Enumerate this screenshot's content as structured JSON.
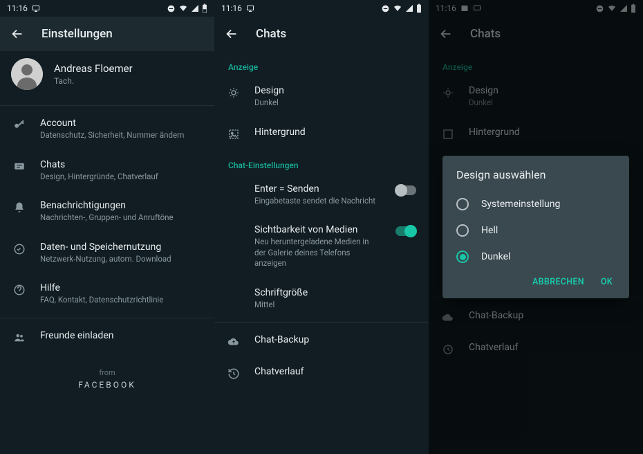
{
  "status": {
    "time": "11:16"
  },
  "pane1": {
    "title": "Einstellungen",
    "profile": {
      "name": "Andreas Floemer",
      "status": "Tach."
    },
    "items": [
      {
        "title": "Account",
        "sub": "Datenschutz, Sicherheit, Nummer ändern"
      },
      {
        "title": "Chats",
        "sub": "Design, Hintergründe, Chatverlauf"
      },
      {
        "title": "Benachrichtigungen",
        "sub": "Nachrichten-, Gruppen- und Anruftöne"
      },
      {
        "title": "Daten- und Speichernutzung",
        "sub": "Netzwerk-Nutzung, autom. Download"
      },
      {
        "title": "Hilfe",
        "sub": "FAQ, Kontakt, Datenschutzrichtlinie"
      },
      {
        "title": "Freunde einladen"
      }
    ],
    "footer": {
      "from": "from",
      "brand": "FACEBOOK"
    }
  },
  "pane2": {
    "title": "Chats",
    "section1": "Anzeige",
    "design": {
      "title": "Design",
      "value": "Dunkel"
    },
    "wallpaper": "Hintergrund",
    "section2": "Chat-Einstellungen",
    "enterSend": {
      "title": "Enter = Senden",
      "sub": "Eingabetaste sendet die Nachricht"
    },
    "mediaVis": {
      "title": "Sichtbarkeit von Medien",
      "sub": "Neu heruntergeladene Medien in der Galerie deines Telefons anzeigen"
    },
    "font": {
      "title": "Schriftgröße",
      "value": "Mittel"
    },
    "backup": "Chat-Backup",
    "history": "Chatverlauf"
  },
  "dialog": {
    "title": "Design auswählen",
    "options": [
      "Systemeinstellung",
      "Hell",
      "Dunkel"
    ],
    "cancel": "ABBRECHEN",
    "ok": "OK"
  }
}
